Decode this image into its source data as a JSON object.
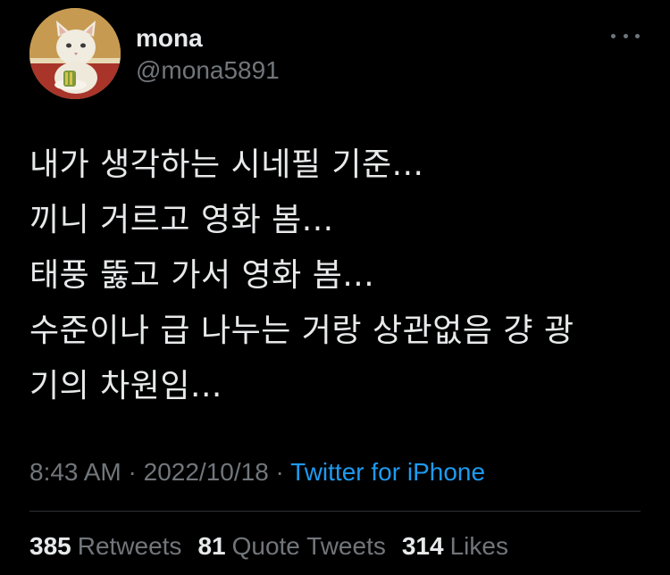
{
  "tweet": {
    "author": {
      "display_name": "mona",
      "handle": "@mona5891"
    },
    "text_lines": [
      "내가 생각하는 시네필 기준...",
      "끼니 거르고 영화 봄...",
      "태풍 뚫고 가서 영화 봄...",
      "수준이나 급 나누는 거랑 상관없음 걍 광",
      "기의 차원임..."
    ],
    "meta": {
      "time": "8:43 AM",
      "separator1": " · ",
      "date": "2022/10/18",
      "separator2": " · ",
      "source": "Twitter for iPhone"
    },
    "stats": {
      "retweets_count": "385",
      "retweets_label": "Retweets",
      "quotes_count": "81",
      "quotes_label": "Quote Tweets",
      "likes_count": "314",
      "likes_label": "Likes"
    }
  },
  "icons": {
    "avatar": "cat-avatar",
    "more": "more-options-icon"
  },
  "colors": {
    "background": "#000000",
    "text_primary": "#e7e9ea",
    "text_secondary": "#71767b",
    "link": "#1d9bf0",
    "divider": "#2f3336"
  }
}
